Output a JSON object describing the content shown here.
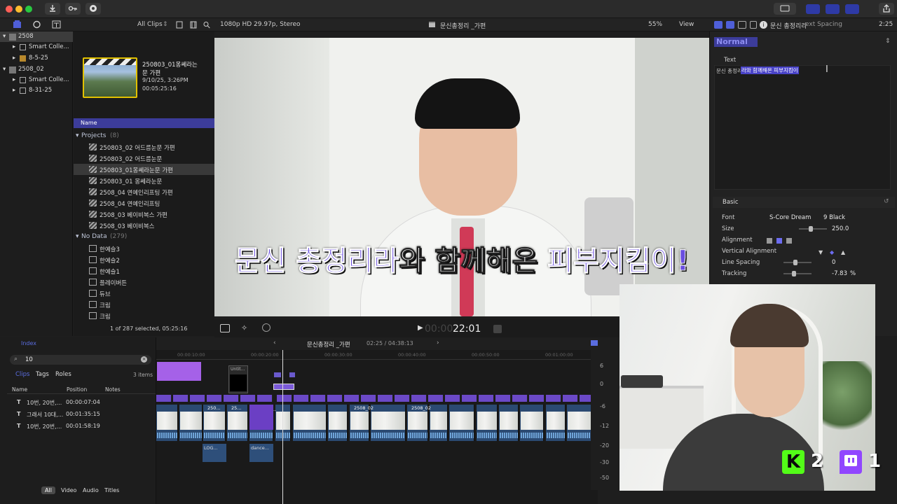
{
  "toolbar": {
    "icons": [
      "import-icon",
      "keyword-icon",
      "background-tasks-icon",
      "share-icon"
    ],
    "accent_color": "#2e3aa6"
  },
  "browser_bar": {
    "filter_label": "All Clips",
    "format_info": "1080p HD 29.97p, Stereo",
    "project_title": "문신총정리 _가편",
    "zoom": "55%",
    "view_label": "View",
    "inspector_title": "문신 총정리라",
    "inspector_param": "ext Spacing",
    "inspector_time": "2:25"
  },
  "libraries": {
    "items": [
      {
        "label": "2508",
        "selected": true
      },
      {
        "label": "Smart Colle..."
      },
      {
        "label": "8-5-25"
      },
      {
        "label": "2508_02"
      },
      {
        "label": "Smart Colle..."
      },
      {
        "label": "8-31-25"
      }
    ]
  },
  "browser": {
    "clip": {
      "name_line1": "250803_01몽쎄라는",
      "name_line2": "문 가편",
      "date": "9/10/25, 3:26PM",
      "duration": "00:05:25:16"
    },
    "name_header": "Name",
    "projects_group": "Projects",
    "projects_count": "(8)",
    "projects": [
      "250803_02 어드름눈문 가편",
      "250803_02 어드름눈문",
      "250803_01몽쎄라눈문 가편",
      "250803_01 몽쎄라눈문",
      "2508_04 연예인리프팅 가편",
      "2508_04 연예인리프팅",
      "2508_03 베이비복스 가편",
      "2508_03 베이비복스"
    ],
    "nodata_group": "No Data",
    "nodata_count": "(279)",
    "nodata_items": [
      "한예슬3",
      "한예슬2",
      "한예슬1",
      "플레이버튼",
      "듀브",
      "크림",
      "크림"
    ],
    "status": "1 of 287 selected, 05:25:16"
  },
  "viewer": {
    "subtitle_part1": "문신 총정리라",
    "subtitle_part2": "와 함께해온 ",
    "subtitle_part3": "피부지킴이!",
    "subtitle_color": "#6a4ee0",
    "timecode_dim": "00:00",
    "timecode": "22:01"
  },
  "inspector": {
    "style_label": "Normal",
    "text_section": "Text",
    "text_plain": "문신 총정리",
    "text_highlight": "라와 함께해온 피부지킴이",
    "basic_section": "Basic",
    "rows": [
      {
        "label": "Font",
        "value": "S-Core Dream",
        "value2": "9 Black"
      },
      {
        "label": "Size",
        "value": "250.0"
      },
      {
        "label": "Alignment",
        "value": ""
      },
      {
        "label": "Vertical Alignment",
        "value": ""
      },
      {
        "label": "Line Spacing",
        "value": "0"
      },
      {
        "label": "Tracking",
        "value": "-7.83",
        "unit": "%"
      }
    ]
  },
  "timeline_index": {
    "tab_index": "Index",
    "search_value": "10",
    "tabs": [
      "Clips",
      "Tags",
      "Roles"
    ],
    "items_count": "3 items",
    "columns": [
      "Name",
      "Position",
      "Notes"
    ],
    "rows": [
      {
        "name": "10번, 20번,...",
        "position": "00:00:07:04"
      },
      {
        "name": "그래서 10대,...",
        "position": "00:01:35:15"
      },
      {
        "name": "10번, 20번,...",
        "position": "00:01:58:19"
      }
    ],
    "filters": [
      "All",
      "Video",
      "Audio",
      "Titles"
    ]
  },
  "timeline": {
    "project": "문신총정리 _가편",
    "timecode": "02:25 / 04:38:13",
    "ruler": [
      "00:00:10:00",
      "00:00:20:00",
      "00:00:30:00",
      "00:00:40:00",
      "00:00:50:00",
      "00:01:00:00"
    ],
    "clip_labels": [
      "Untit...",
      "250...",
      "25...",
      "손문 터번...",
      "2508_02",
      "2508_02",
      "LOG...",
      "dance..."
    ]
  },
  "meters": {
    "scale": [
      "6",
      "0",
      "-6",
      "-12",
      "-20",
      "-30",
      "-50"
    ]
  },
  "overlay": {
    "kick_count": "2",
    "twitch_count": "1",
    "kick_color": "#53fc18",
    "twitch_color": "#9146ff"
  }
}
